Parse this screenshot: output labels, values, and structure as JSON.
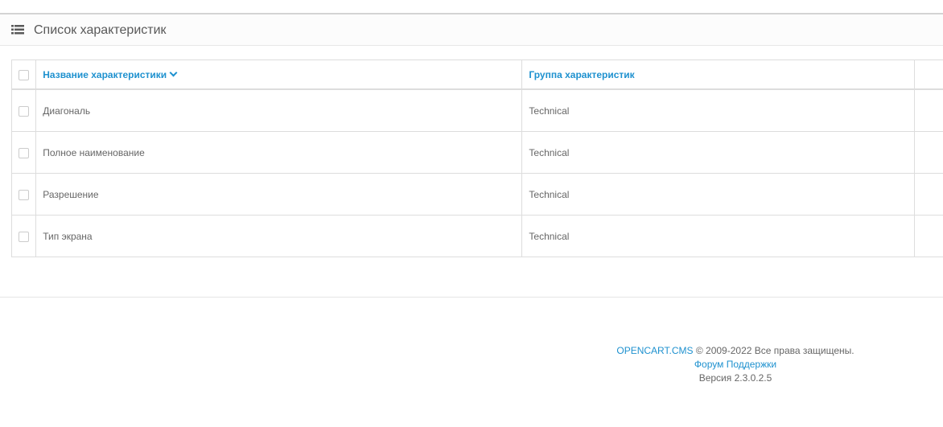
{
  "panel": {
    "title": "Список характеристик",
    "icon": "list-icon"
  },
  "table": {
    "columns": {
      "name": "Название характеристики",
      "group": "Группа характеристик"
    },
    "rows": [
      {
        "name": "Диагональ",
        "group": "Technical"
      },
      {
        "name": "Полное наименование",
        "group": "Technical"
      },
      {
        "name": "Разрешение",
        "group": "Technical"
      },
      {
        "name": "Тип экрана",
        "group": "Technical"
      }
    ]
  },
  "footer": {
    "brand": "OPENCART.CMS",
    "copyright": "© 2009-2022 Все права защищены.",
    "forum": "Форум Поддержки",
    "version": "Версия 2.3.0.2.5"
  },
  "colors": {
    "link": "#1e91cf",
    "text": "#666666",
    "border": "#dddddd"
  }
}
